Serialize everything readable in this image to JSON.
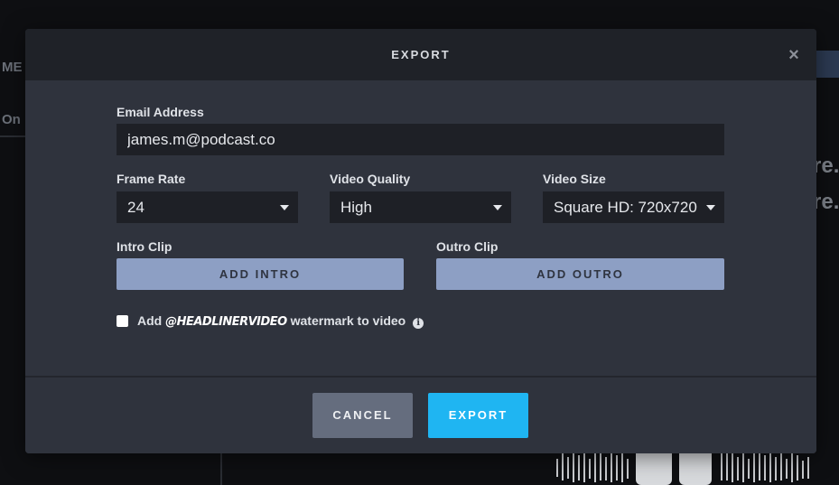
{
  "background": {
    "left_fragments": [
      "ME",
      "On"
    ],
    "right_fragments": [
      "re.",
      "re."
    ]
  },
  "modal": {
    "title": "EXPORT",
    "close_glyph": "×",
    "email": {
      "label": "Email Address",
      "value": "james.m@podcast.co",
      "placeholder": ""
    },
    "frame_rate": {
      "label": "Frame Rate",
      "selected": "24"
    },
    "video_quality": {
      "label": "Video Quality",
      "selected": "High"
    },
    "video_size": {
      "label": "Video Size",
      "selected": "Square HD: 720x720"
    },
    "intro_clip": {
      "label": "Intro Clip",
      "button": "ADD INTRO"
    },
    "outro_clip": {
      "label": "Outro Clip",
      "button": "ADD OUTRO"
    },
    "watermark": {
      "prefix": "Add",
      "brand": "@HEADLINERVIDEO",
      "suffix": "watermark to video",
      "checked": false,
      "info_glyph": "i"
    },
    "footer": {
      "cancel": "CANCEL",
      "export": "EXPORT"
    }
  },
  "colors": {
    "accent": "#1fb5f2",
    "clip_button": "#8d9fc4",
    "cancel_button": "#656d7e",
    "modal_bg": "#2f333d",
    "header_bg": "#1f2228",
    "input_bg": "#1e2026"
  }
}
